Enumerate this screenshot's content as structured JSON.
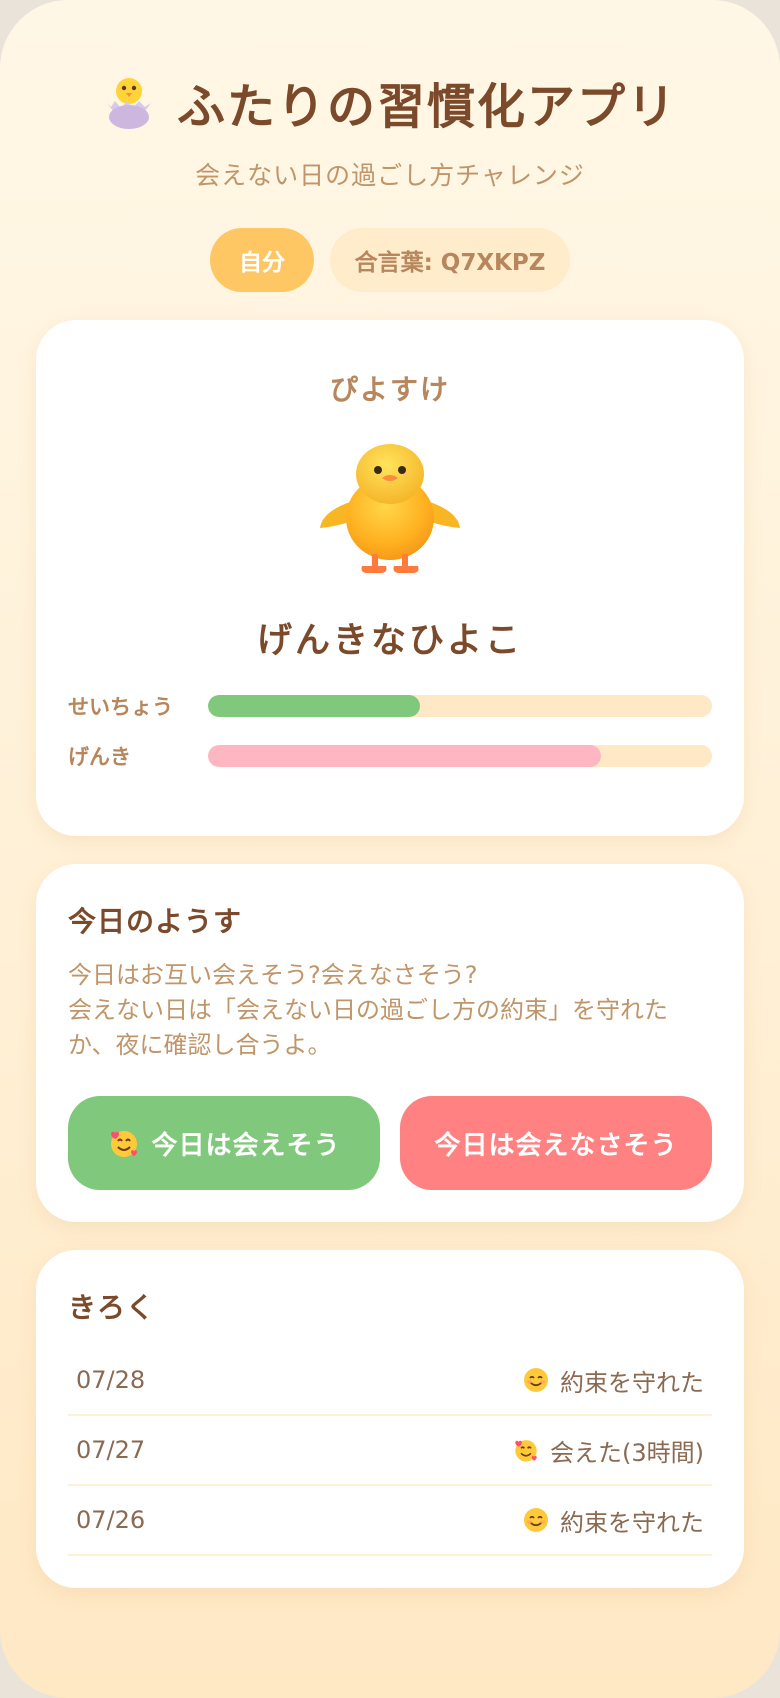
{
  "header": {
    "logo_icon": "hatching-chick-icon",
    "title": "ふたりの習慣化アプリ",
    "subtitle": "会えない日の過ごし方チャレンジ"
  },
  "pills": {
    "self_label": "自分",
    "code_label": "合言葉: Q7XKPZ"
  },
  "pet": {
    "name": "ぴよすけ",
    "icon": "baby-chick-icon",
    "status": "げんきなひよこ",
    "stats": [
      {
        "label": "せいちょう",
        "value": 0.42,
        "color": "#80c87b"
      },
      {
        "label": "げんき",
        "value": 0.78,
        "color": "#ffb6c3"
      }
    ]
  },
  "today": {
    "title": "今日のようす",
    "desc_lines": [
      "今日はお互い会えそう?会えなさそう?",
      "会えない日は「会えない日の過ごし方の約束」を守れた",
      "か、夜に確認し合うよ。"
    ],
    "meet_button": {
      "icon": "smiling-face-with-hearts-icon",
      "label": "今日は会えそう",
      "color": "#80c87b"
    },
    "nomeet_button": {
      "label": "今日は会えなさそう",
      "color": "#ff8182"
    }
  },
  "log": {
    "title": "きろく",
    "entries": [
      {
        "date": "07/28",
        "icon": "smiling-face-icon",
        "text": "約束を守れた"
      },
      {
        "date": "07/27",
        "icon": "smiling-face-with-hearts-icon",
        "text": "会えた(3時間)"
      },
      {
        "date": "07/26",
        "icon": "smiling-face-icon",
        "text": "約束を守れた"
      }
    ]
  }
}
